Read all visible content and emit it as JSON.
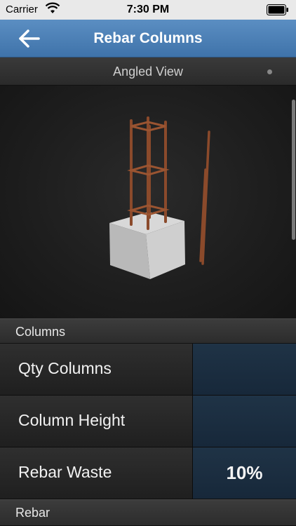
{
  "status_bar": {
    "carrier": "Carrier",
    "time": "7:30 PM"
  },
  "nav": {
    "title": "Rebar Columns",
    "back_icon": "arrow-left-icon"
  },
  "view": {
    "label": "Angled View"
  },
  "sections": {
    "columns": {
      "title": "Columns"
    },
    "rebar": {
      "title": "Rebar"
    }
  },
  "rows": [
    {
      "label": "Qty Columns",
      "value": ""
    },
    {
      "label": "Column Height",
      "value": ""
    },
    {
      "label": "Rebar Waste",
      "value": "10%"
    }
  ],
  "colors": {
    "nav_blue": "#4a80b8",
    "rebar": "#8b4a2b",
    "concrete": "#d6d6d6",
    "value_bg": "#1c2f42"
  }
}
